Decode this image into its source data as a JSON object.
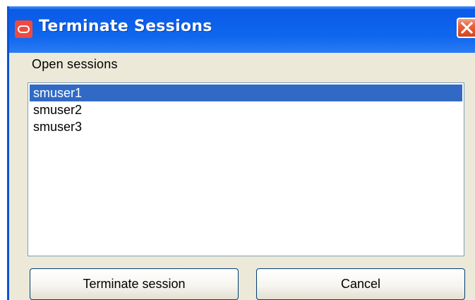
{
  "window": {
    "title": "Terminate Sessions",
    "icon": "oracle-icon",
    "close_icon": "close-icon"
  },
  "sessions": {
    "label": "Open sessions",
    "items": [
      {
        "name": "smuser1",
        "selected": true
      },
      {
        "name": "smuser2",
        "selected": false
      },
      {
        "name": "smuser3",
        "selected": false
      }
    ]
  },
  "buttons": {
    "terminate_label": "Terminate session",
    "cancel_label": "Cancel"
  },
  "colors": {
    "titlebar": "#0a59e8",
    "selection": "#316ac5",
    "dialog_bg": "#ece9d8",
    "close_button": "#e6623d",
    "app_icon": "#ef4a3f"
  }
}
